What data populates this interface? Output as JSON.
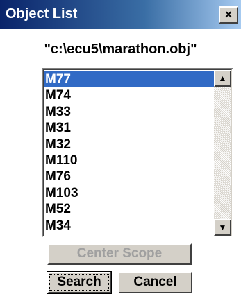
{
  "window": {
    "title": "Object List",
    "close_glyph": "×"
  },
  "file_path": "\"c:\\ecu5\\marathon.obj\"",
  "list": {
    "items": [
      "M77",
      "M74",
      "M33",
      "M31",
      "M32",
      "M110",
      "M76",
      "M103",
      "M52",
      "M34"
    ],
    "selected": "M77"
  },
  "scrollbar": {
    "up_glyph": "▲",
    "down_glyph": "▼"
  },
  "buttons": {
    "center_scope": "Center Scope",
    "search": "Search",
    "cancel": "Cancel"
  },
  "colors": {
    "selection": "#316ac5",
    "title_start": "#0a246a",
    "face": "#d4d0c8"
  }
}
